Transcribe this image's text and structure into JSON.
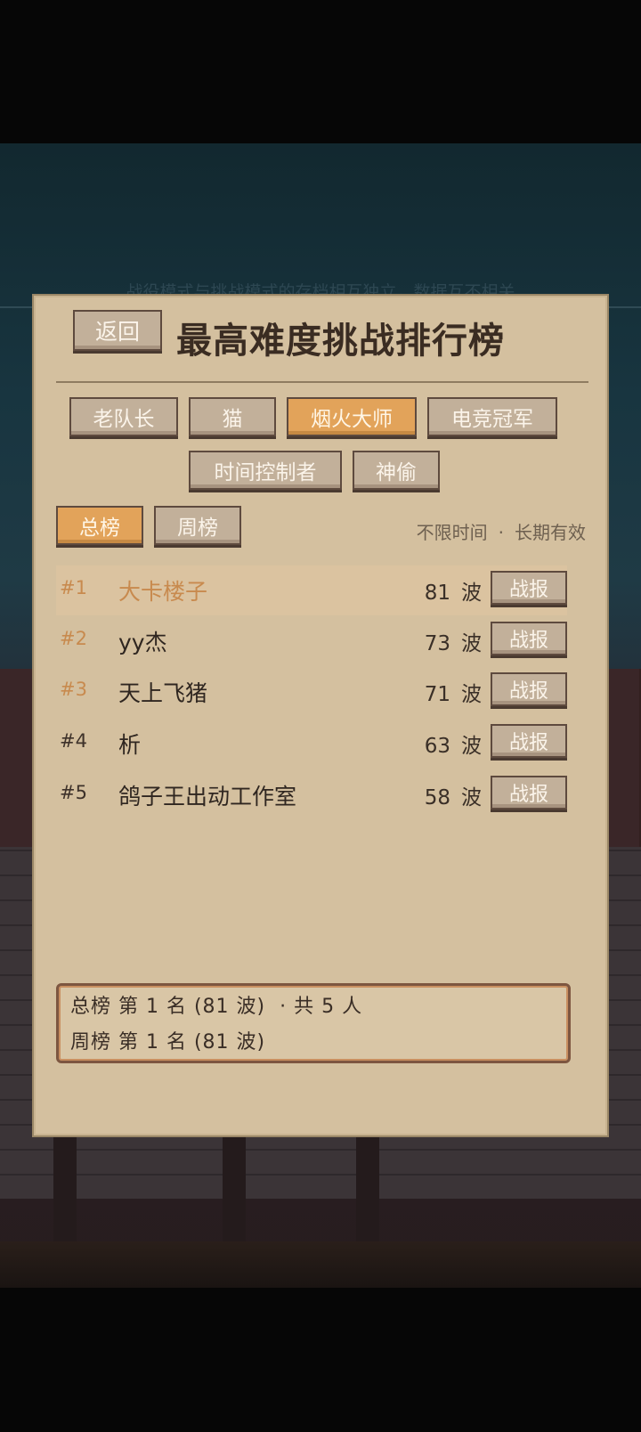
{
  "background": {
    "notice": "战役模式与挑战模式的存档相互独立，数据互不相关"
  },
  "dialog": {
    "back_label": "返回",
    "title": "最高难度挑战排行榜"
  },
  "character_tabs": [
    {
      "label": "老队长",
      "active": false
    },
    {
      "label": "猫",
      "active": false
    },
    {
      "label": "烟火大师",
      "active": true
    },
    {
      "label": "电竞冠军",
      "active": false
    },
    {
      "label": "时间控制者",
      "active": false
    },
    {
      "label": "神偷",
      "active": false
    }
  ],
  "board_tabs": [
    {
      "label": "总榜",
      "active": true
    },
    {
      "label": "周榜",
      "active": false
    }
  ],
  "period": {
    "time": "不限时间",
    "separator": "·",
    "validity": "长期有效"
  },
  "rankings": [
    {
      "rank": "#1",
      "name": "大卡楼子",
      "waves": "81",
      "unit": "波",
      "report_label": "战报"
    },
    {
      "rank": "#2",
      "name": "yy杰",
      "waves": "73",
      "unit": "波",
      "report_label": "战报"
    },
    {
      "rank": "#3",
      "name": "天上飞猪",
      "waves": "71",
      "unit": "波",
      "report_label": "战报"
    },
    {
      "rank": "#4",
      "name": "析",
      "waves": "63",
      "unit": "波",
      "report_label": "战报"
    },
    {
      "rank": "#5",
      "name": "鸽子王出动工作室",
      "waves": "58",
      "unit": "波",
      "report_label": "战报"
    }
  ],
  "summary": {
    "line1": "总榜 第 1 名 (81 波)  · 共 5 人",
    "line2": "周榜 第 1 名 (81 波)"
  },
  "colors": {
    "panel": "#d4c09f",
    "button": "#c2b09a",
    "active_button": "#e2a35a",
    "highlight_text": "#c88a4e"
  }
}
